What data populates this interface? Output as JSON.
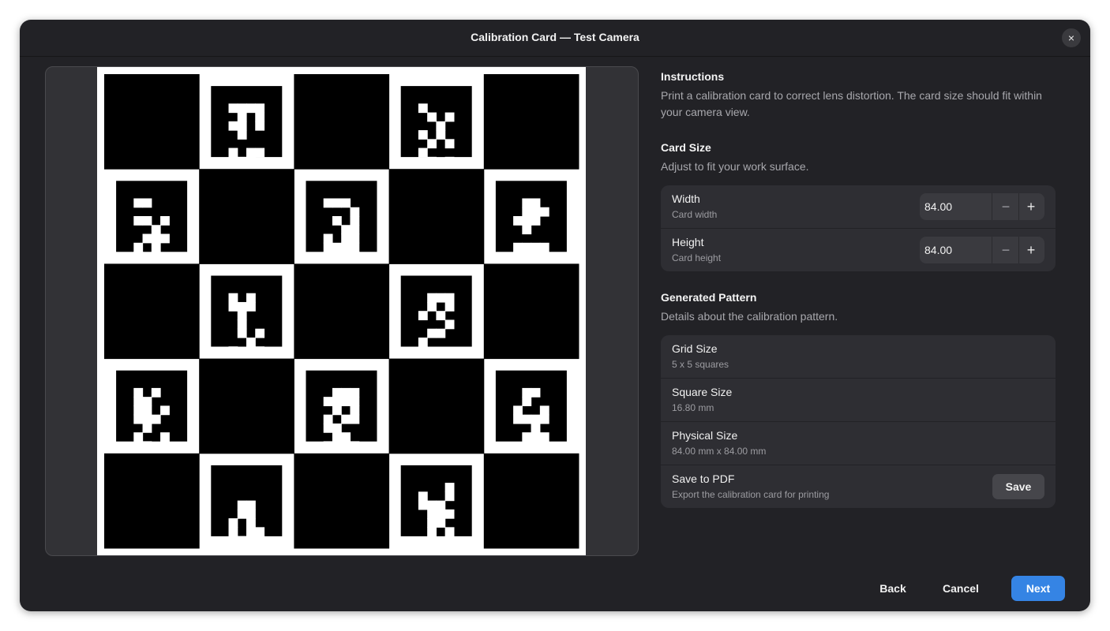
{
  "window": {
    "title": "Calibration Card — Test Camera",
    "close_icon": "×"
  },
  "card": {
    "grid_cols": 5,
    "grid_rows": 5,
    "marker_bits": [
      null,
      [
        "1111",
        "0101",
        "1101",
        "0100",
        "0000",
        "1011",
        "1110",
        "0111"
      ],
      null,
      [
        "1000",
        "0101",
        "0010",
        "1010",
        "0101",
        "1000",
        "0101",
        "0011"
      ],
      null,
      [
        "1100",
        "0000",
        "1101",
        "0010",
        "0111",
        "1010",
        "1000",
        "1101"
      ],
      null,
      [
        "1110",
        "0001",
        "0101",
        "0011",
        "1011",
        "1111",
        "0111",
        "1110"
      ],
      null,
      [
        "0110",
        "0111",
        "1110",
        "0100",
        "0000",
        "1111",
        "1100",
        "1010"
      ],
      null,
      [
        "1010",
        "1110",
        "0100",
        "0100",
        "0101",
        "0010",
        "1011",
        "0101"
      ],
      null,
      [
        "0111",
        "0101",
        "1010",
        "0001",
        "0110",
        "1000",
        "1000",
        "1110"
      ],
      null,
      [
        "1010",
        "1100",
        "1101",
        "1110",
        "0100",
        "1001",
        "0100",
        "1100"
      ],
      null,
      [
        "0111",
        "1111",
        "0101",
        "1011",
        "1100",
        "0110",
        "1011",
        "0110"
      ],
      null,
      [
        "0110",
        "0100",
        "1001",
        "1111",
        "0010",
        "0111",
        "0010",
        "1111"
      ],
      null,
      [
        "0000",
        "0000",
        "0110",
        "0110",
        "1010",
        "1011",
        "0111",
        "1111"
      ],
      null,
      [
        "0001",
        "1001",
        "1110",
        "0111",
        "0110",
        "0101",
        "0001",
        "1000"
      ],
      null
    ]
  },
  "instructions": {
    "title": "Instructions",
    "description": "Print a calibration card to correct lens distortion. The card size should fit within your camera view."
  },
  "card_size": {
    "title": "Card Size",
    "description": "Adjust to fit your work surface.",
    "rows": [
      {
        "label": "Width",
        "sublabel": "Card width",
        "value": "84.00"
      },
      {
        "label": "Height",
        "sublabel": "Card height",
        "value": "84.00"
      }
    ],
    "minus_icon": "−",
    "plus_icon": "+"
  },
  "pattern": {
    "title": "Generated Pattern",
    "description": "Details about the calibration pattern.",
    "rows": [
      {
        "label": "Grid Size",
        "sublabel": "5 x 5 squares"
      },
      {
        "label": "Square Size",
        "sublabel": "16.80 mm"
      },
      {
        "label": "Physical Size",
        "sublabel": "84.00 mm x 84.00 mm"
      },
      {
        "label": "Save to PDF",
        "sublabel": "Export the calibration card for printing",
        "button": "Save"
      }
    ]
  },
  "footer": {
    "back": "Back",
    "cancel": "Cancel",
    "next": "Next"
  },
  "colors": {
    "accent": "#3584e4",
    "background": "#222226",
    "card_black": "#000000",
    "card_white": "#ffffff"
  }
}
